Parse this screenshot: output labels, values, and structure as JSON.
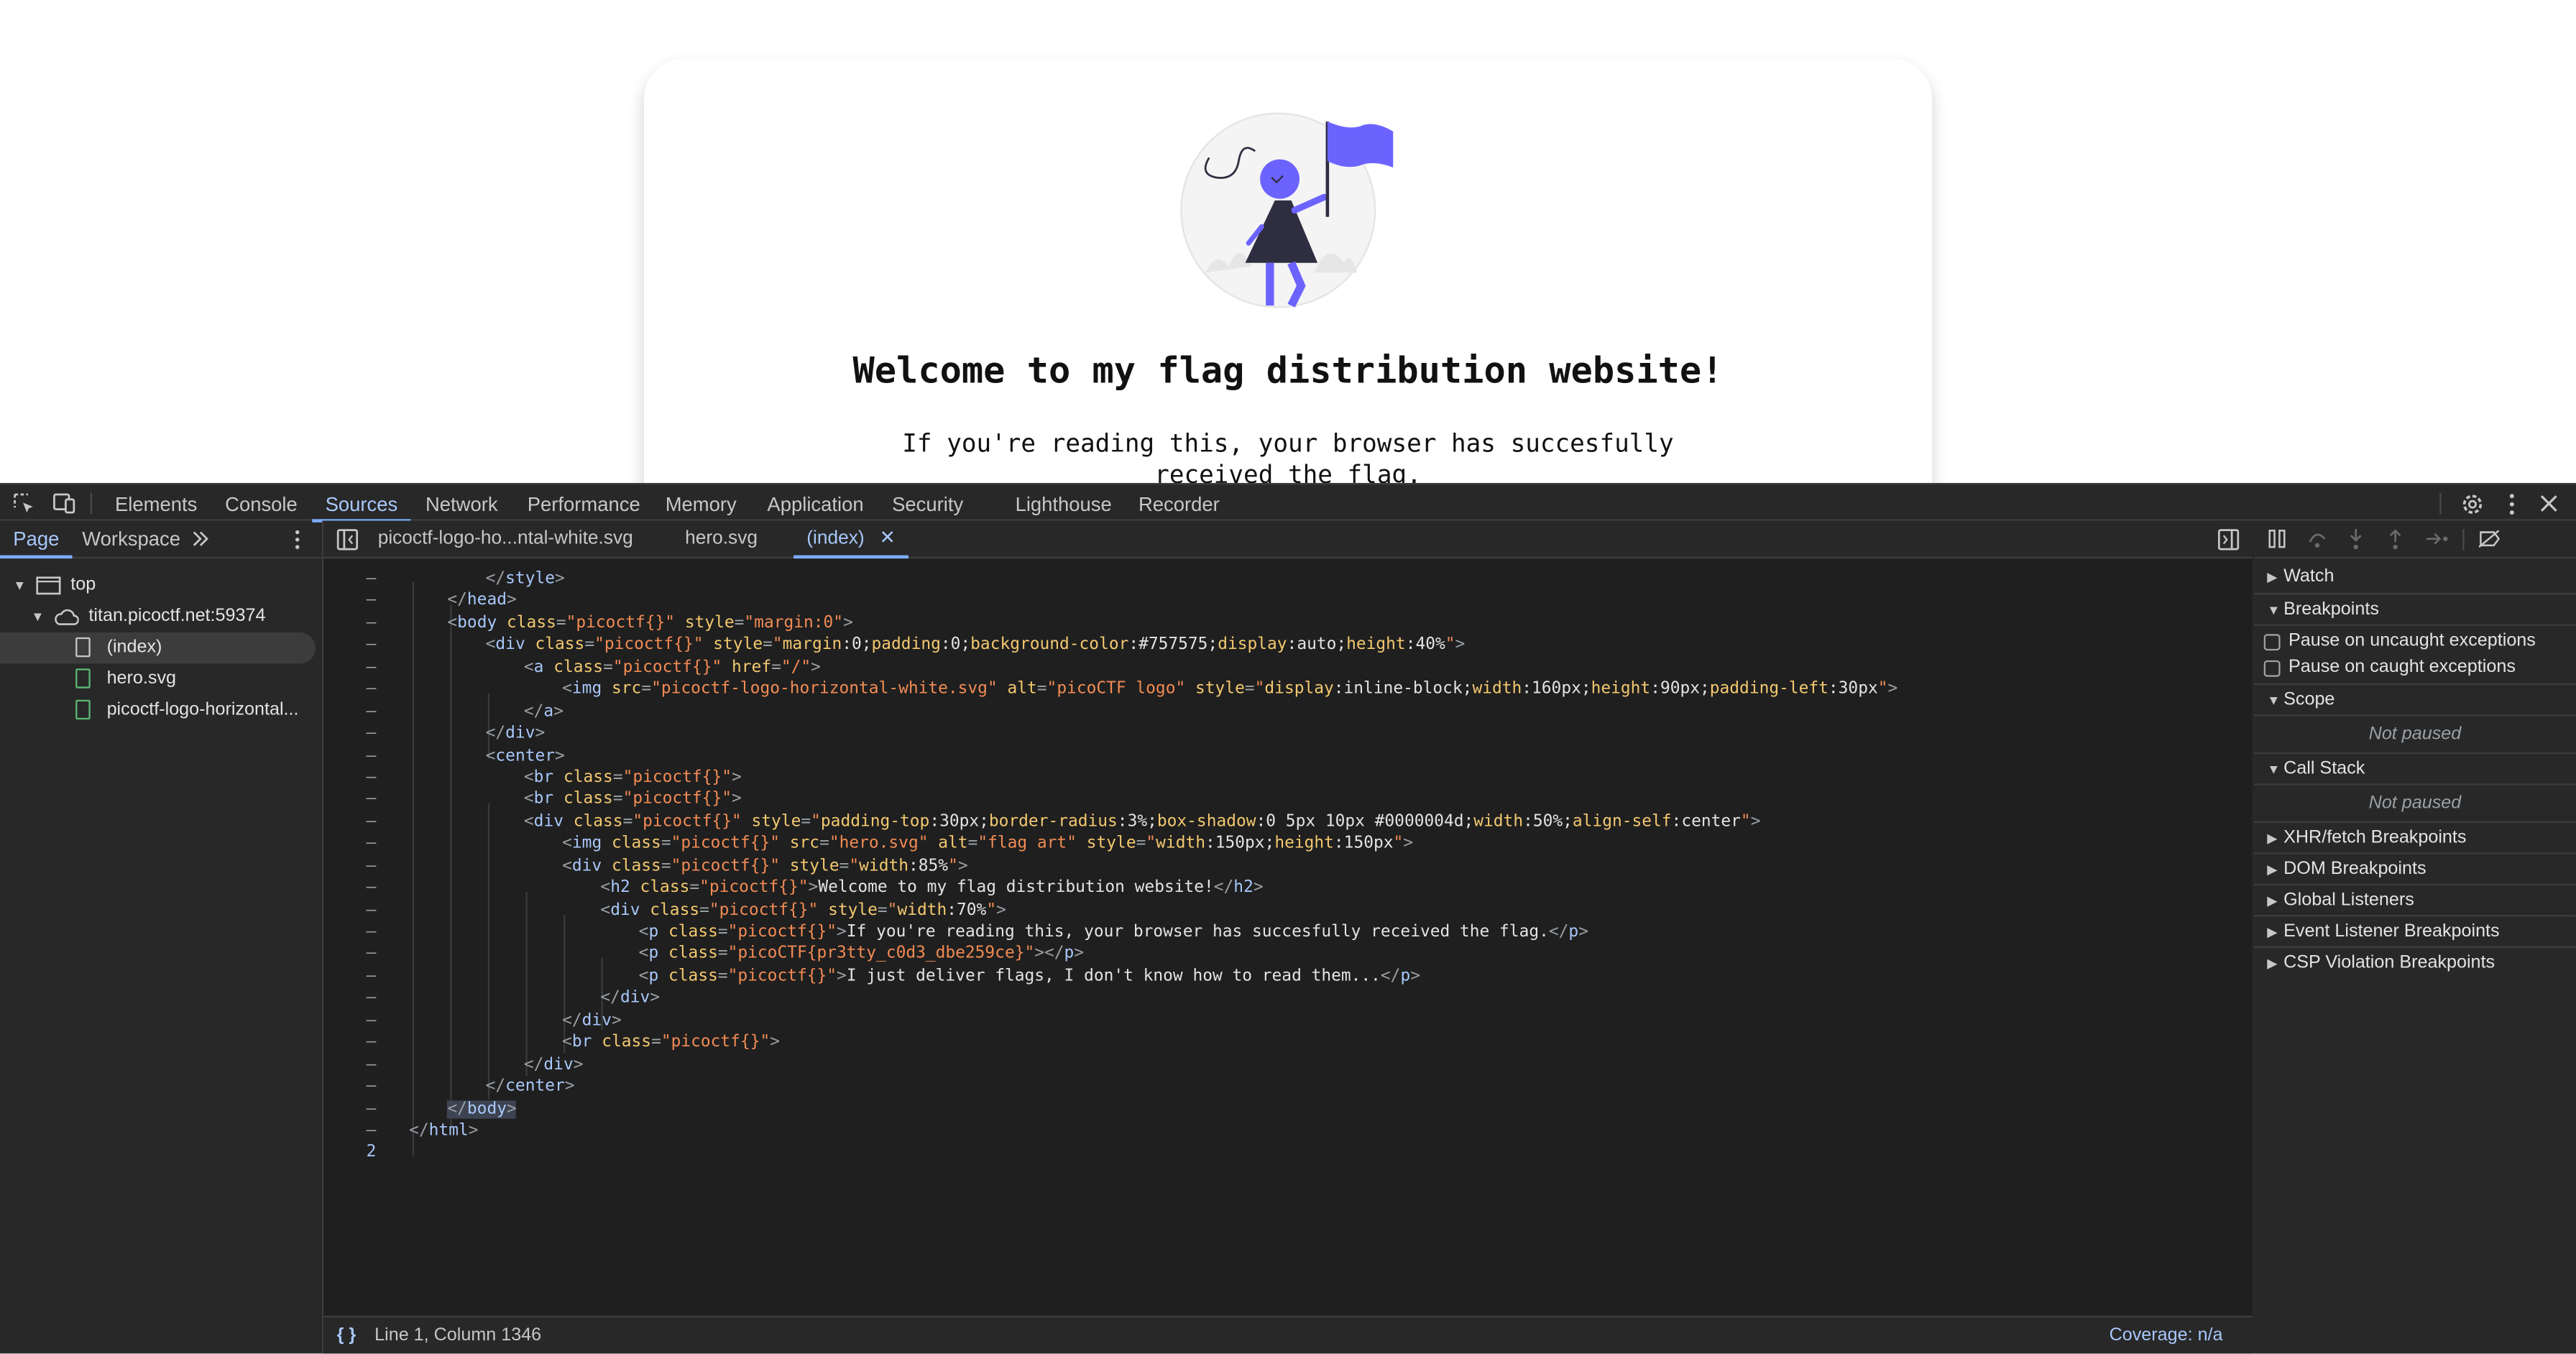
{
  "page": {
    "heading": "Welcome to my flag distribution website!",
    "paragraph": "If you're reading this, your browser has succesfully received the flag."
  },
  "devtools": {
    "main_tabs": [
      "Elements",
      "Console",
      "Sources",
      "Network",
      "Performance",
      "Memory",
      "Application",
      "Security",
      "Lighthouse",
      "Recorder"
    ],
    "active_tab": "Sources",
    "nav_tabs": {
      "page": "Page",
      "workspace": "Workspace"
    },
    "tree": {
      "top": "top",
      "host": "titan.picoctf.net:59374",
      "files": [
        "(index)",
        "hero.svg",
        "picoctf-logo-horizontal..."
      ]
    },
    "editor_tabs": [
      "picoctf-logo-ho...ntal-white.svg",
      "hero.svg",
      "(index)"
    ],
    "code_lines": [
      {
        "g": "–",
        "i": 2,
        "html": "<span class=\"g\">&lt;/</span><span class=\"t\">style</span><span class=\"g\">&gt;</span>"
      },
      {
        "g": "–",
        "i": 1,
        "html": "<span class=\"g\">&lt;/</span><span class=\"t\">head</span><span class=\"g\">&gt;</span>"
      },
      {
        "g": "–",
        "i": 1,
        "html": "<span class=\"g\">&lt;</span><span class=\"t\">body</span> <span class=\"a\">class</span><span class=\"g\">=</span><span class=\"v\">\"picoctf{}\"</span> <span class=\"a\">style</span><span class=\"g\">=</span><span class=\"v\">\"margin:0\"</span><span class=\"g\">&gt;</span>"
      },
      {
        "g": "–",
        "i": 2,
        "html": "<span class=\"g\">&lt;</span><span class=\"t\">div</span> <span class=\"a\">class</span><span class=\"g\">=</span><span class=\"v\">\"picoctf{}\"</span> <span class=\"a\">style</span><span class=\"g\">=</span><span class=\"v\">\"</span><span class=\"a\">margin</span><span class=\"p\">:0;</span><span class=\"a\">padding</span><span class=\"p\">:0;</span><span class=\"a\">background-color</span><span class=\"p\">:#757575;</span><span class=\"a\">display</span><span class=\"p\">:auto;</span><span class=\"a\">height</span><span class=\"p\">:40%</span><span class=\"v\">\"</span><span class=\"g\">&gt;</span>"
      },
      {
        "g": "–",
        "i": 3,
        "html": "<span class=\"g\">&lt;</span><span class=\"t\">a</span> <span class=\"a\">class</span><span class=\"g\">=</span><span class=\"v\">\"picoctf{}\"</span> <span class=\"a\">href</span><span class=\"g\">=</span><span class=\"v\">\"/\"</span><span class=\"g\">&gt;</span>"
      },
      {
        "g": "–",
        "i": 4,
        "html": "<span class=\"g\">&lt;</span><span class=\"t\">img</span> <span class=\"a\">src</span><span class=\"g\">=</span><span class=\"v\">\"picoctf-logo-horizontal-white.svg\"</span> <span class=\"a\">alt</span><span class=\"g\">=</span><span class=\"v\">\"picoCTF logo\"</span> <span class=\"a\">style</span><span class=\"g\">=</span><span class=\"v\">\"</span><span class=\"a\">display</span><span class=\"p\">:inline-block;</span><span class=\"a\">width</span><span class=\"p\">:160px;</span><span class=\"a\">height</span><span class=\"p\">:90px;</span><span class=\"a\">padding-left</span><span class=\"p\">:30px</span><span class=\"v\">\"</span><span class=\"g\">&gt;</span>"
      },
      {
        "g": "–",
        "i": 3,
        "html": "<span class=\"g\">&lt;/</span><span class=\"t\">a</span><span class=\"g\">&gt;</span>"
      },
      {
        "g": "–",
        "i": 2,
        "html": "<span class=\"g\">&lt;/</span><span class=\"t\">div</span><span class=\"g\">&gt;</span>"
      },
      {
        "g": "–",
        "i": 2,
        "html": "<span class=\"g\">&lt;</span><span class=\"t\">center</span><span class=\"g\">&gt;</span>"
      },
      {
        "g": "–",
        "i": 3,
        "html": "<span class=\"g\">&lt;</span><span class=\"t\">br</span> <span class=\"a\">class</span><span class=\"g\">=</span><span class=\"v\">\"picoctf{}\"</span><span class=\"g\">&gt;</span>"
      },
      {
        "g": "–",
        "i": 3,
        "html": "<span class=\"g\">&lt;</span><span class=\"t\">br</span> <span class=\"a\">class</span><span class=\"g\">=</span><span class=\"v\">\"picoctf{}\"</span><span class=\"g\">&gt;</span>"
      },
      {
        "g": "–",
        "i": 3,
        "html": "<span class=\"g\">&lt;</span><span class=\"t\">div</span> <span class=\"a\">class</span><span class=\"g\">=</span><span class=\"v\">\"picoctf{}\"</span> <span class=\"a\">style</span><span class=\"g\">=</span><span class=\"v\">\"</span><span class=\"a\">padding-top</span><span class=\"p\">:30px;</span><span class=\"a\">border-radius</span><span class=\"p\">:3%;</span><span class=\"a\">box-shadow</span><span class=\"p\">:0 5px 10px #0000004d;</span><span class=\"a\">width</span><span class=\"p\">:50%;</span><span class=\"a\">align-self</span><span class=\"p\">:center</span><span class=\"v\">\"</span><span class=\"g\">&gt;</span>"
      },
      {
        "g": "–",
        "i": 4,
        "html": "<span class=\"g\">&lt;</span><span class=\"t\">img</span> <span class=\"a\">class</span><span class=\"g\">=</span><span class=\"v\">\"picoctf{}\"</span> <span class=\"a\">src</span><span class=\"g\">=</span><span class=\"v\">\"hero.svg\"</span> <span class=\"a\">alt</span><span class=\"g\">=</span><span class=\"v\">\"flag art\"</span> <span class=\"a\">style</span><span class=\"g\">=</span><span class=\"v\">\"</span><span class=\"a\">width</span><span class=\"p\">:150px;</span><span class=\"a\">height</span><span class=\"p\">:150px</span><span class=\"v\">\"</span><span class=\"g\">&gt;</span>"
      },
      {
        "g": "–",
        "i": 4,
        "html": "<span class=\"g\">&lt;</span><span class=\"t\">div</span> <span class=\"a\">class</span><span class=\"g\">=</span><span class=\"v\">\"picoctf{}\"</span> <span class=\"a\">style</span><span class=\"g\">=</span><span class=\"v\">\"</span><span class=\"a\">width</span><span class=\"p\">:85%</span><span class=\"v\">\"</span><span class=\"g\">&gt;</span>"
      },
      {
        "g": "–",
        "i": 5,
        "html": "<span class=\"g\">&lt;</span><span class=\"t\">h2</span> <span class=\"a\">class</span><span class=\"g\">=</span><span class=\"v\">\"picoctf{}\"</span><span class=\"g\">&gt;</span><span class=\"p\">Welcome to my flag distribution website!</span><span class=\"g\">&lt;/</span><span class=\"t\">h2</span><span class=\"g\">&gt;</span>"
      },
      {
        "g": "–",
        "i": 5,
        "html": "<span class=\"g\">&lt;</span><span class=\"t\">div</span> <span class=\"a\">class</span><span class=\"g\">=</span><span class=\"v\">\"picoctf{}\"</span> <span class=\"a\">style</span><span class=\"g\">=</span><span class=\"v\">\"</span><span class=\"a\">width</span><span class=\"p\">:70%</span><span class=\"v\">\"</span><span class=\"g\">&gt;</span>"
      },
      {
        "g": "–",
        "i": 6,
        "html": "<span class=\"g\">&lt;</span><span class=\"t\">p</span> <span class=\"a\">class</span><span class=\"g\">=</span><span class=\"v\">\"picoctf{}\"</span><span class=\"g\">&gt;</span><span class=\"p\">If you're reading this, your browser has succesfully received the flag.</span><span class=\"g\">&lt;/</span><span class=\"t\">p</span><span class=\"g\">&gt;</span>"
      },
      {
        "g": "–",
        "i": 6,
        "html": "<span class=\"g\">&lt;</span><span class=\"t\">p</span> <span class=\"a\">class</span><span class=\"g\">=</span><span class=\"v\">\"picoCTF{pr3tty_c0d3_dbe259ce}\"</span><span class=\"g\">&gt;&lt;/</span><span class=\"t\">p</span><span class=\"g\">&gt;</span>"
      },
      {
        "g": "–",
        "i": 6,
        "html": "<span class=\"g\">&lt;</span><span class=\"t\">p</span> <span class=\"a\">class</span><span class=\"g\">=</span><span class=\"v\">\"picoctf{}\"</span><span class=\"g\">&gt;</span><span class=\"p\">I just deliver flags, I don't know how to read them...</span><span class=\"g\">&lt;/</span><span class=\"t\">p</span><span class=\"g\">&gt;</span>"
      },
      {
        "g": "–",
        "i": 5,
        "html": "<span class=\"g\">&lt;/</span><span class=\"t\">div</span><span class=\"g\">&gt;</span>"
      },
      {
        "g": "–",
        "i": 4,
        "html": "<span class=\"g\">&lt;/</span><span class=\"t\">div</span><span class=\"g\">&gt;</span>"
      },
      {
        "g": "–",
        "i": 4,
        "html": "<span class=\"g\">&lt;</span><span class=\"t\">br</span> <span class=\"a\">class</span><span class=\"g\">=</span><span class=\"v\">\"picoctf{}\"</span><span class=\"g\">&gt;</span>"
      },
      {
        "g": "–",
        "i": 3,
        "html": "<span class=\"g\">&lt;/</span><span class=\"t\">div</span><span class=\"g\">&gt;</span>"
      },
      {
        "g": "–",
        "i": 2,
        "html": "<span class=\"g\">&lt;/</span><span class=\"t\">center</span><span class=\"g\">&gt;</span>"
      },
      {
        "g": "–",
        "i": 1,
        "html": "<span class=\"hl\"><span class=\"g\">&lt;/</span><span class=\"t\">body</span><span class=\"g\">&gt;</span></span>"
      },
      {
        "g": "–",
        "i": 0,
        "html": "<span class=\"g\">&lt;/</span><span class=\"t\">html</span><span class=\"g\">&gt;</span>"
      },
      {
        "g": "2",
        "i": 0,
        "html": ""
      }
    ],
    "status": {
      "position": "Line 1, Column 1346",
      "coverage": "Coverage: n/a"
    },
    "debugger": {
      "watch": "Watch",
      "breakpoints": "Breakpoints",
      "pause_uncaught": "Pause on uncaught exceptions",
      "pause_caught": "Pause on caught exceptions",
      "scope": "Scope",
      "not_paused": "Not paused",
      "call_stack": "Call Stack",
      "xhr": "XHR/fetch Breakpoints",
      "dom": "DOM Breakpoints",
      "global": "Global Listeners",
      "event": "Event Listener Breakpoints",
      "csp": "CSP Violation Breakpoints"
    }
  },
  "colors": {
    "accent": "#7cacf8",
    "panel_bg": "#282828",
    "editor_bg": "#1f1f1f",
    "hero_purple": "#6c63ff"
  }
}
